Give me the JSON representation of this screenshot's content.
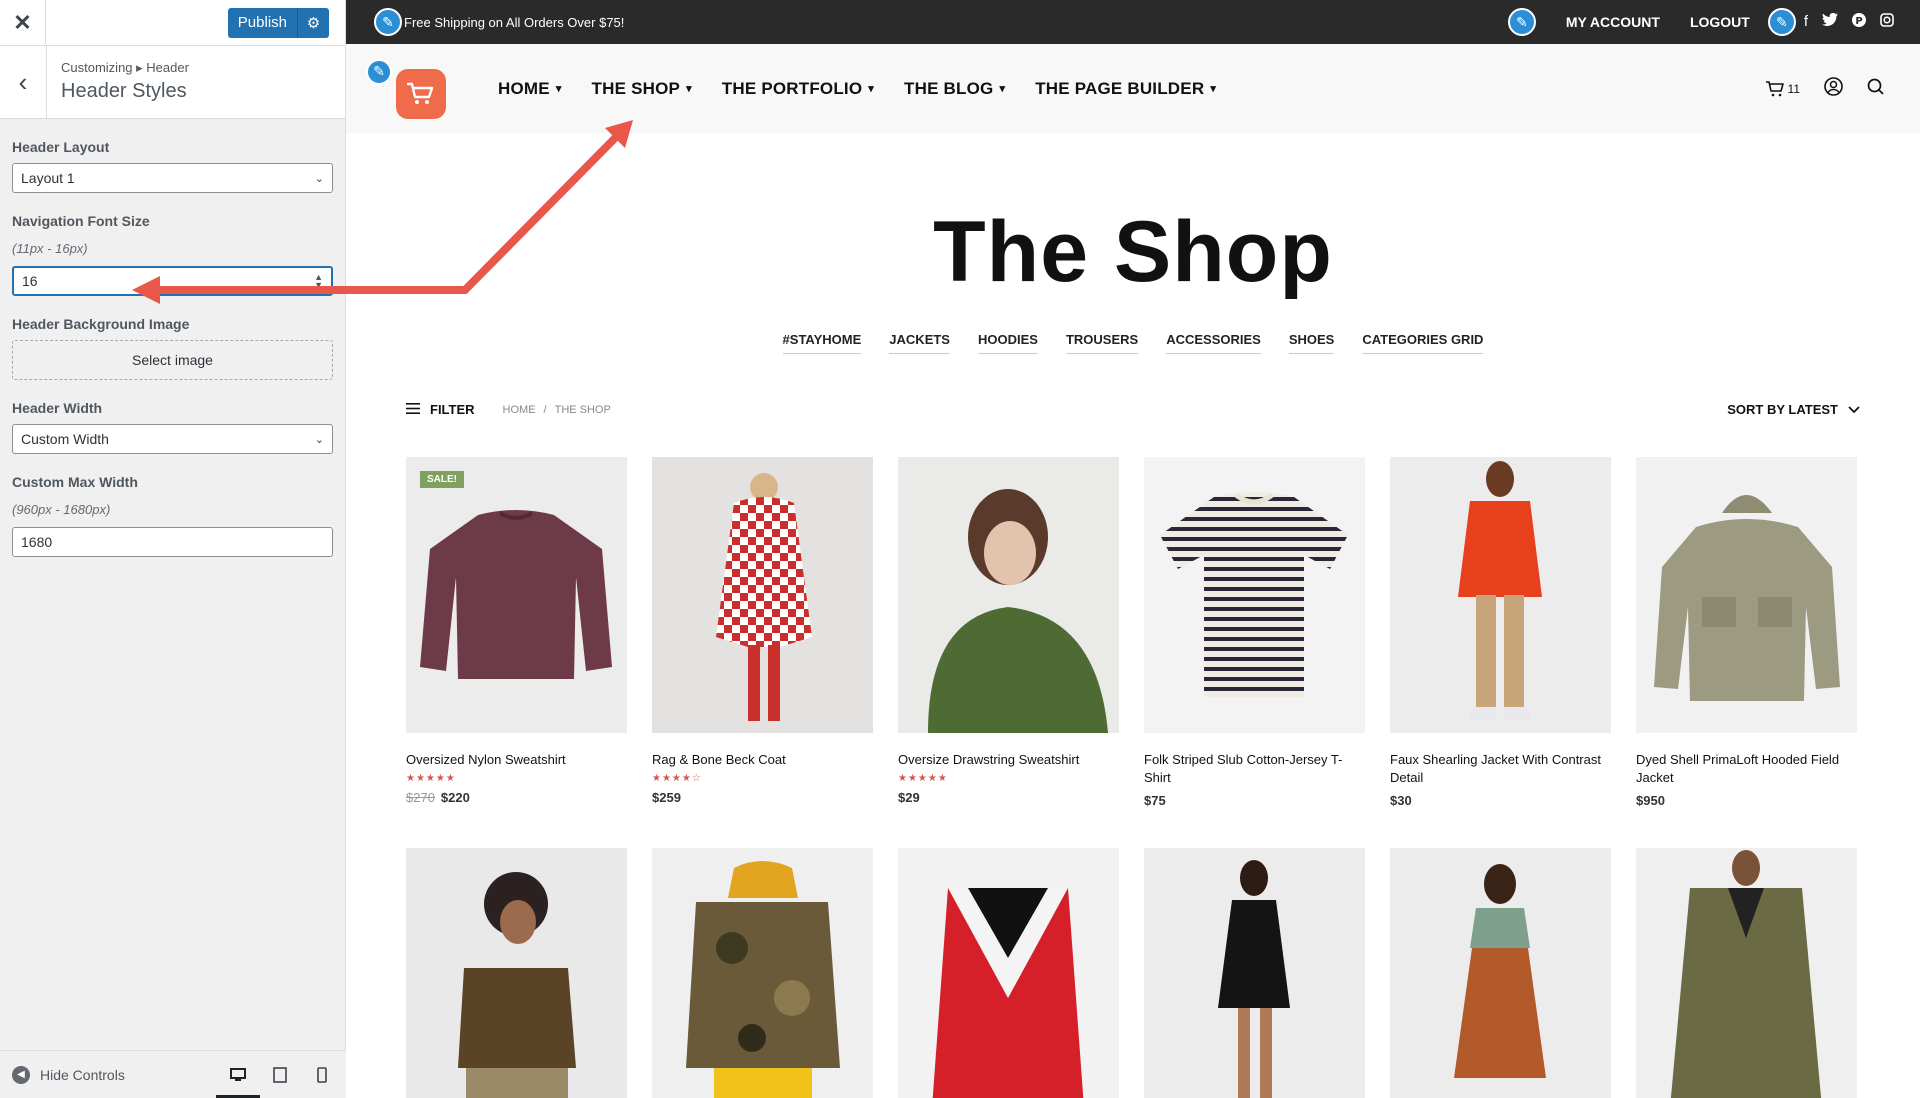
{
  "sidebar": {
    "close_icon": "close-icon",
    "publish_label": "Publish",
    "breadcrumb": "Customizing ▸ Header",
    "title": "Header Styles",
    "header_layout": {
      "label": "Header Layout",
      "value": "Layout 1"
    },
    "nav_font_size": {
      "label": "Navigation Font Size",
      "hint": "(11px - 16px)",
      "value": "16"
    },
    "bg_image": {
      "label": "Header Background Image",
      "button": "Select image"
    },
    "header_width": {
      "label": "Header Width",
      "value": "Custom Width"
    },
    "max_width": {
      "label": "Custom Max Width",
      "hint": "(960px - 1680px)",
      "value": "1680"
    },
    "hide_controls": "Hide Controls"
  },
  "preview": {
    "topbar": {
      "shipping": "Free Shipping on All Orders Over $75!",
      "my_account": "MY ACCOUNT",
      "logout": "LOGOUT"
    },
    "nav": [
      "HOME",
      "THE SHOP",
      "THE PORTFOLIO",
      "THE BLOG",
      "THE PAGE BUILDER"
    ],
    "cart_count": "11",
    "title": "The Shop",
    "categories": [
      "#STAYHOME",
      "JACKETS",
      "HOODIES",
      "TROUSERS",
      "ACCESSORIES",
      "SHOES",
      "CATEGORIES GRID"
    ],
    "filter": "FILTER",
    "breadcrumb": {
      "home": "HOME",
      "sep": "/",
      "current": "THE SHOP"
    },
    "sort": "SORT BY LATEST",
    "sale_badge": "SALE!",
    "products": [
      {
        "name": "Oversized Nylon Sweatshirt",
        "stars": "★★★★★",
        "old_price": "$270",
        "price": "$220"
      },
      {
        "name": "Rag & Bone Beck Coat",
        "stars": "★★★★☆",
        "old_price": "",
        "price": "$259"
      },
      {
        "name": "Oversize Drawstring Sweatshirt",
        "stars": "★★★★★",
        "old_price": "",
        "price": "$29"
      },
      {
        "name": "Folk Striped Slub Cotton-Jersey T-Shirt",
        "stars": "",
        "old_price": "",
        "price": "$75"
      },
      {
        "name": "Faux Shearling Jacket With Contrast Detail",
        "stars": "",
        "old_price": "",
        "price": "$30"
      },
      {
        "name": "Dyed Shell PrimaLoft Hooded Field Jacket",
        "stars": "",
        "old_price": "",
        "price": "$950"
      }
    ]
  },
  "colors": {
    "accent_blue": "#2271b1",
    "logo_orange": "#ef6b4a",
    "arrow_red": "#e8574a",
    "topbar_bg": "#2a2a2a"
  }
}
